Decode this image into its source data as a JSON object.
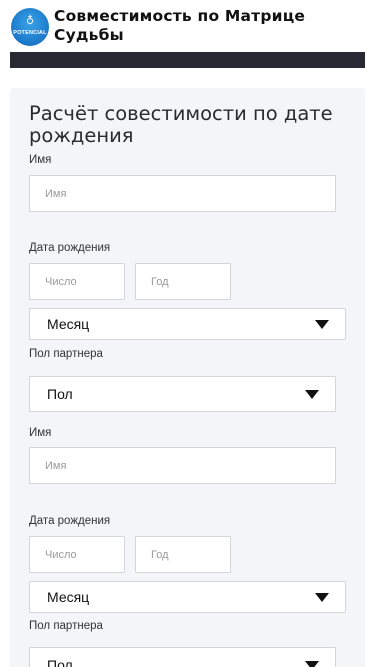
{
  "header": {
    "logo_mark": "♁",
    "logo_text": "POTENCIAL",
    "title": "Совместимость по Матрице Судьбы"
  },
  "form": {
    "title": "Расчёт совестимости по дате рождения",
    "person1": {
      "name_label": "Имя",
      "name_placeholder": "Имя",
      "birth_label": "Дата рождения",
      "day_placeholder": "Число",
      "year_placeholder": "Год",
      "month_value": "Месяц",
      "gender_label": "Пол партнера",
      "gender_value": "Пол"
    },
    "person2": {
      "name_label": "Имя",
      "name_placeholder": "Имя",
      "birth_label": "Дата рождения",
      "day_placeholder": "Число",
      "year_placeholder": "Год",
      "month_value": "Месяц",
      "gender_label": "Пол партнера",
      "gender_value": "Пол"
    }
  },
  "icons": {
    "logo": "astrology-globe-icon",
    "dropdown": "chevron-down-icon"
  },
  "colors": {
    "logo_blue": "#1a78c9",
    "nav_bar": "#272a33",
    "card_bg": "#f4f5f7"
  }
}
